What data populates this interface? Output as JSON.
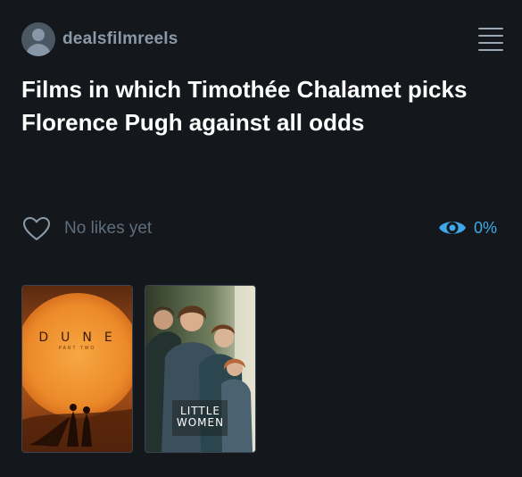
{
  "header": {
    "username": "dealsfilmreels",
    "avatar_icon": "user-avatar-icon",
    "menu_icon": "hamburger-menu-icon"
  },
  "list": {
    "title": "Films in which Timothée Chalamet picks Florence Pugh against all odds",
    "likes_text": "No likes yet",
    "views_percent": "0%",
    "like_icon": "heart-outline-icon",
    "views_icon": "eye-icon"
  },
  "posters": [
    {
      "film": "Dune: Part Two",
      "title_text": "DUNE",
      "subtitle_text": "PART TWO"
    },
    {
      "film": "Little Women",
      "title_line1": "LITTLE",
      "title_line2": "WOMEN"
    }
  ],
  "colors": {
    "background": "#14181c",
    "title": "#ffffff",
    "username": "#8a99a8",
    "muted": "#5f6e7c",
    "accent": "#3ea8e8"
  }
}
